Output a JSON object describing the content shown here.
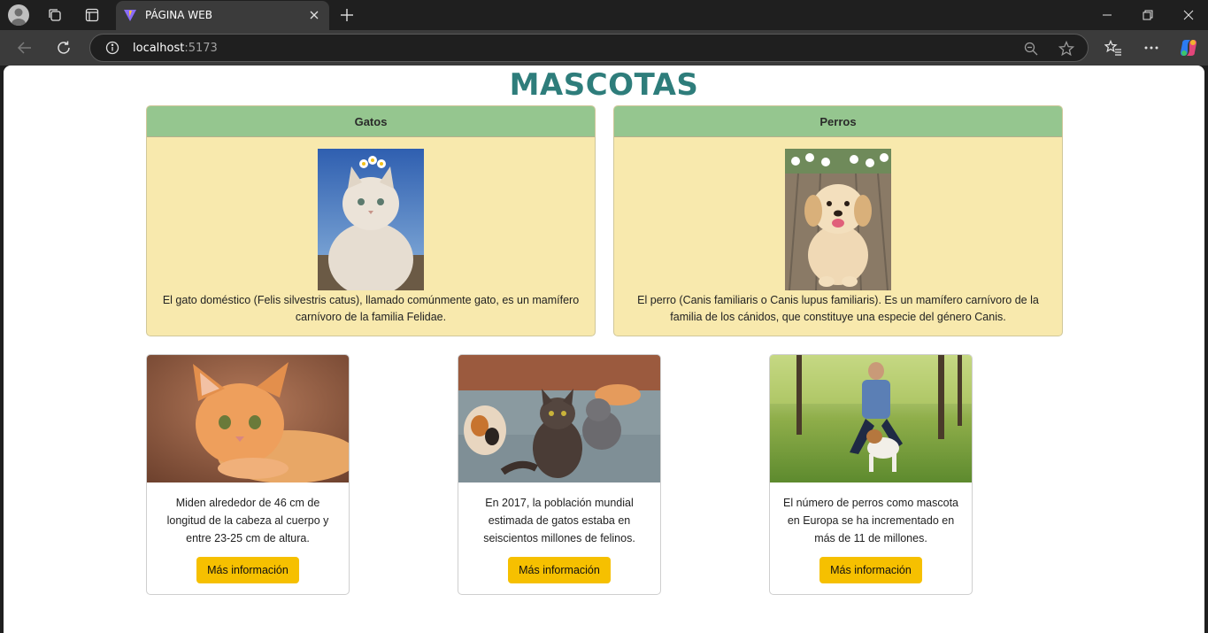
{
  "browser": {
    "tab_title": "PÁGINA WEB",
    "url_host": "localhost",
    "url_port": ":5173",
    "colors": {
      "tabbar": "#1f1f1f",
      "toolbar": "#3b3b3b"
    }
  },
  "page": {
    "title": "MASCOTAS",
    "title_color": "#2e7d7b",
    "featured_cards": [
      {
        "header": "Gatos",
        "image": "fluffy-cat-with-daisy-crown",
        "text": "El gato doméstico (Felis silvestris catus), llamado comúnmente gato, es un mamífero carnívoro de la familia Felidae."
      },
      {
        "header": "Perros",
        "image": "golden-retriever-puppy",
        "text": "El perro (Canis familiaris o Canis lupus familiaris). Es un mamífero carnívoro de la familia de los cánidos, que constituye una especie del género Canis."
      }
    ],
    "info_cards": [
      {
        "image": "orange-kitten",
        "text": "Miden alrededor de 46 cm de longitud de la cabeza al cuerpo y entre 23-25 cm de altura.",
        "button": "Más información"
      },
      {
        "image": "group-of-cats",
        "text": "En 2017, la población mundial estimada de gatos estaba en seiscientos millones de felinos.",
        "button": "Más información"
      },
      {
        "image": "man-with-dog-in-park",
        "text": "El número de perros como mascota en Europa se ha incrementado en más de 11 de millones.",
        "button": "Más información"
      }
    ],
    "colors": {
      "card_header": "#95c68f",
      "card_body": "#f8e9ad",
      "button": "#f6c000"
    }
  }
}
